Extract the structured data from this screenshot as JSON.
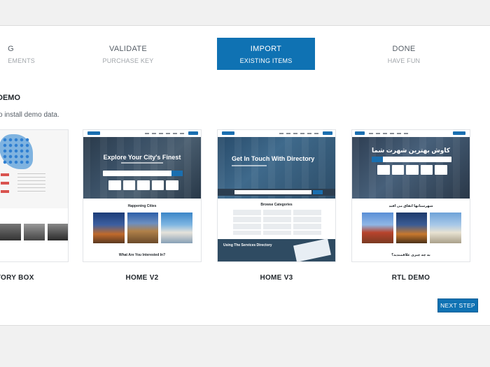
{
  "steps": [
    {
      "title": "G",
      "subtitle": "EMENTS"
    },
    {
      "title": "VALIDATE",
      "subtitle": "PURCHASE KEY"
    },
    {
      "title": "IMPORT",
      "subtitle": "EXISTING ITEMS",
      "active": true
    },
    {
      "title": "DONE",
      "subtitle": "HAVE FUN"
    }
  ],
  "section": {
    "title": "DEMO",
    "description": "o install demo data."
  },
  "demos": [
    {
      "label": "CTORY BOX"
    },
    {
      "label": "HOME V2",
      "hero_title": "Explore Your City's Finest",
      "subheading": "Happening Cities",
      "footer_heading": "What Are You Interested In?"
    },
    {
      "label": "HOME V3",
      "hero_title": "Get In Touch With Directory",
      "subheading": "Browse Categories",
      "band_text": "Using The Services Directory"
    },
    {
      "label": "RTL DEMO",
      "hero_title": "کاوش بهترین شهرت شما",
      "subheading": "شهرستانها اتفاق می افتد",
      "footer_heading": "به چه چیزی علاقمندید؟"
    }
  ],
  "next_step_label": "NEXT STEP",
  "colors": {
    "accent": "#0f72b3",
    "page_bg": "#f1f1f1"
  }
}
